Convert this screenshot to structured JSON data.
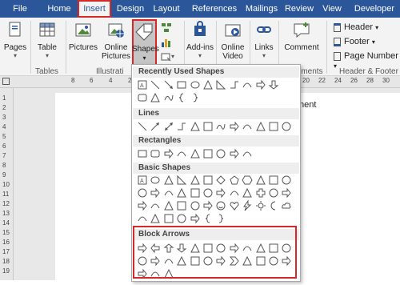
{
  "tabs": [
    "File",
    "Home",
    "Insert",
    "Design",
    "Layout",
    "References",
    "Mailings",
    "Review",
    "View",
    "Developer"
  ],
  "active_tab": "Insert",
  "ribbon": {
    "pages_label": "Pages",
    "table_label": "Table",
    "pictures_label": "Pictures",
    "online_pictures_label": "Online Pictures",
    "shapes_label": "Shapes",
    "addins_label": "Add-ins",
    "online_video_label": "Online Video",
    "links_label": "Links",
    "comment_label": "Comment",
    "header_label": "Header",
    "footer_label": "Footer",
    "page_number_label": "Page Number",
    "groups": {
      "tables": "Tables",
      "illustrations": "Illustrati",
      "comments": "mments",
      "header_footer": "Header & Footer"
    }
  },
  "ruler": {
    "h_left": [
      "8",
      "6",
      "4",
      "2"
    ],
    "h_right": [
      "20",
      "22",
      "24",
      "26",
      "28",
      "30"
    ],
    "v": [
      "1",
      "2",
      "3",
      "4",
      "5",
      "6",
      "7",
      "8",
      "9",
      "10",
      "11",
      "12",
      "13",
      "14",
      "15",
      "16",
      "17",
      "18",
      "19"
    ]
  },
  "document": {
    "text_fragment": "ment"
  },
  "dropdown": {
    "sections": {
      "recent": "Recently Used Shapes",
      "lines": "Lines",
      "rectangles": "Rectangles",
      "basic": "Basic Shapes",
      "block_arrows": "Block Arrows"
    },
    "recent_shapes": [
      "text-box",
      "line",
      "line-arrow",
      "rectangle",
      "oval",
      "triangle",
      "right-triangle",
      "elbow-connector",
      "elbow-arrow",
      "right-arrow",
      "down-arrow"
    ],
    "recent_shapes_2": [
      "rounded-rect",
      "triangle-2",
      "curve",
      "left-brace",
      "right-brace"
    ],
    "line_shapes": [
      "line",
      "arrow",
      "double-arrow",
      "elbow",
      "elbow-arrow",
      "elbow-double",
      "curve",
      "curve-arrow",
      "curve-double",
      "freeform",
      "scribble",
      "freehand"
    ],
    "rect_shapes": [
      "rect",
      "rounded-rect",
      "snip-single",
      "snip-same",
      "snip-diag",
      "snip-round",
      "round-single",
      "round-same",
      "round-diag"
    ],
    "basic_row1": [
      "text-box",
      "oval",
      "triangle",
      "right-triangle",
      "parallelogram",
      "trapezoid",
      "diamond",
      "pentagon",
      "hexagon",
      "heptagon",
      "octagon",
      "decagon"
    ],
    "basic_row2": [
      "12-gon",
      "12-gon-2",
      "pie",
      "chord",
      "teardrop",
      "frame",
      "half-frame",
      "l-shape",
      "diagonal-stripe",
      "cross",
      "plaque",
      "can"
    ],
    "basic_row3": [
      "cube",
      "bevel",
      "donut",
      "no-symbol",
      "block-arc",
      "folded-corner",
      "smiley",
      "heart",
      "lightning",
      "sun",
      "moon",
      "cloud"
    ],
    "basic_row4": [
      "arc",
      "double-bracket",
      "double-brace",
      "left-bracket",
      "right-bracket",
      "left-brace",
      "right-brace"
    ],
    "arrows_row1": [
      "right-arrow",
      "left-arrow",
      "up-arrow",
      "down-arrow",
      "left-right-arrow",
      "up-down-arrow",
      "quad-arrow",
      "left-right-up-arrow",
      "bent-arrow",
      "u-turn-arrow",
      "left-up-arrow",
      "bent-up-arrow"
    ],
    "arrows_row2": [
      "curved-right",
      "curved-left",
      "curved-up",
      "curved-down",
      "striped-right",
      "notched-right",
      "pentagon-arrow",
      "chevron",
      "right-callout",
      "down-callout",
      "left-callout",
      "up-callout"
    ],
    "arrows_row3": [
      "left-right-callout",
      "quad-callout",
      "circular-arrow"
    ]
  }
}
